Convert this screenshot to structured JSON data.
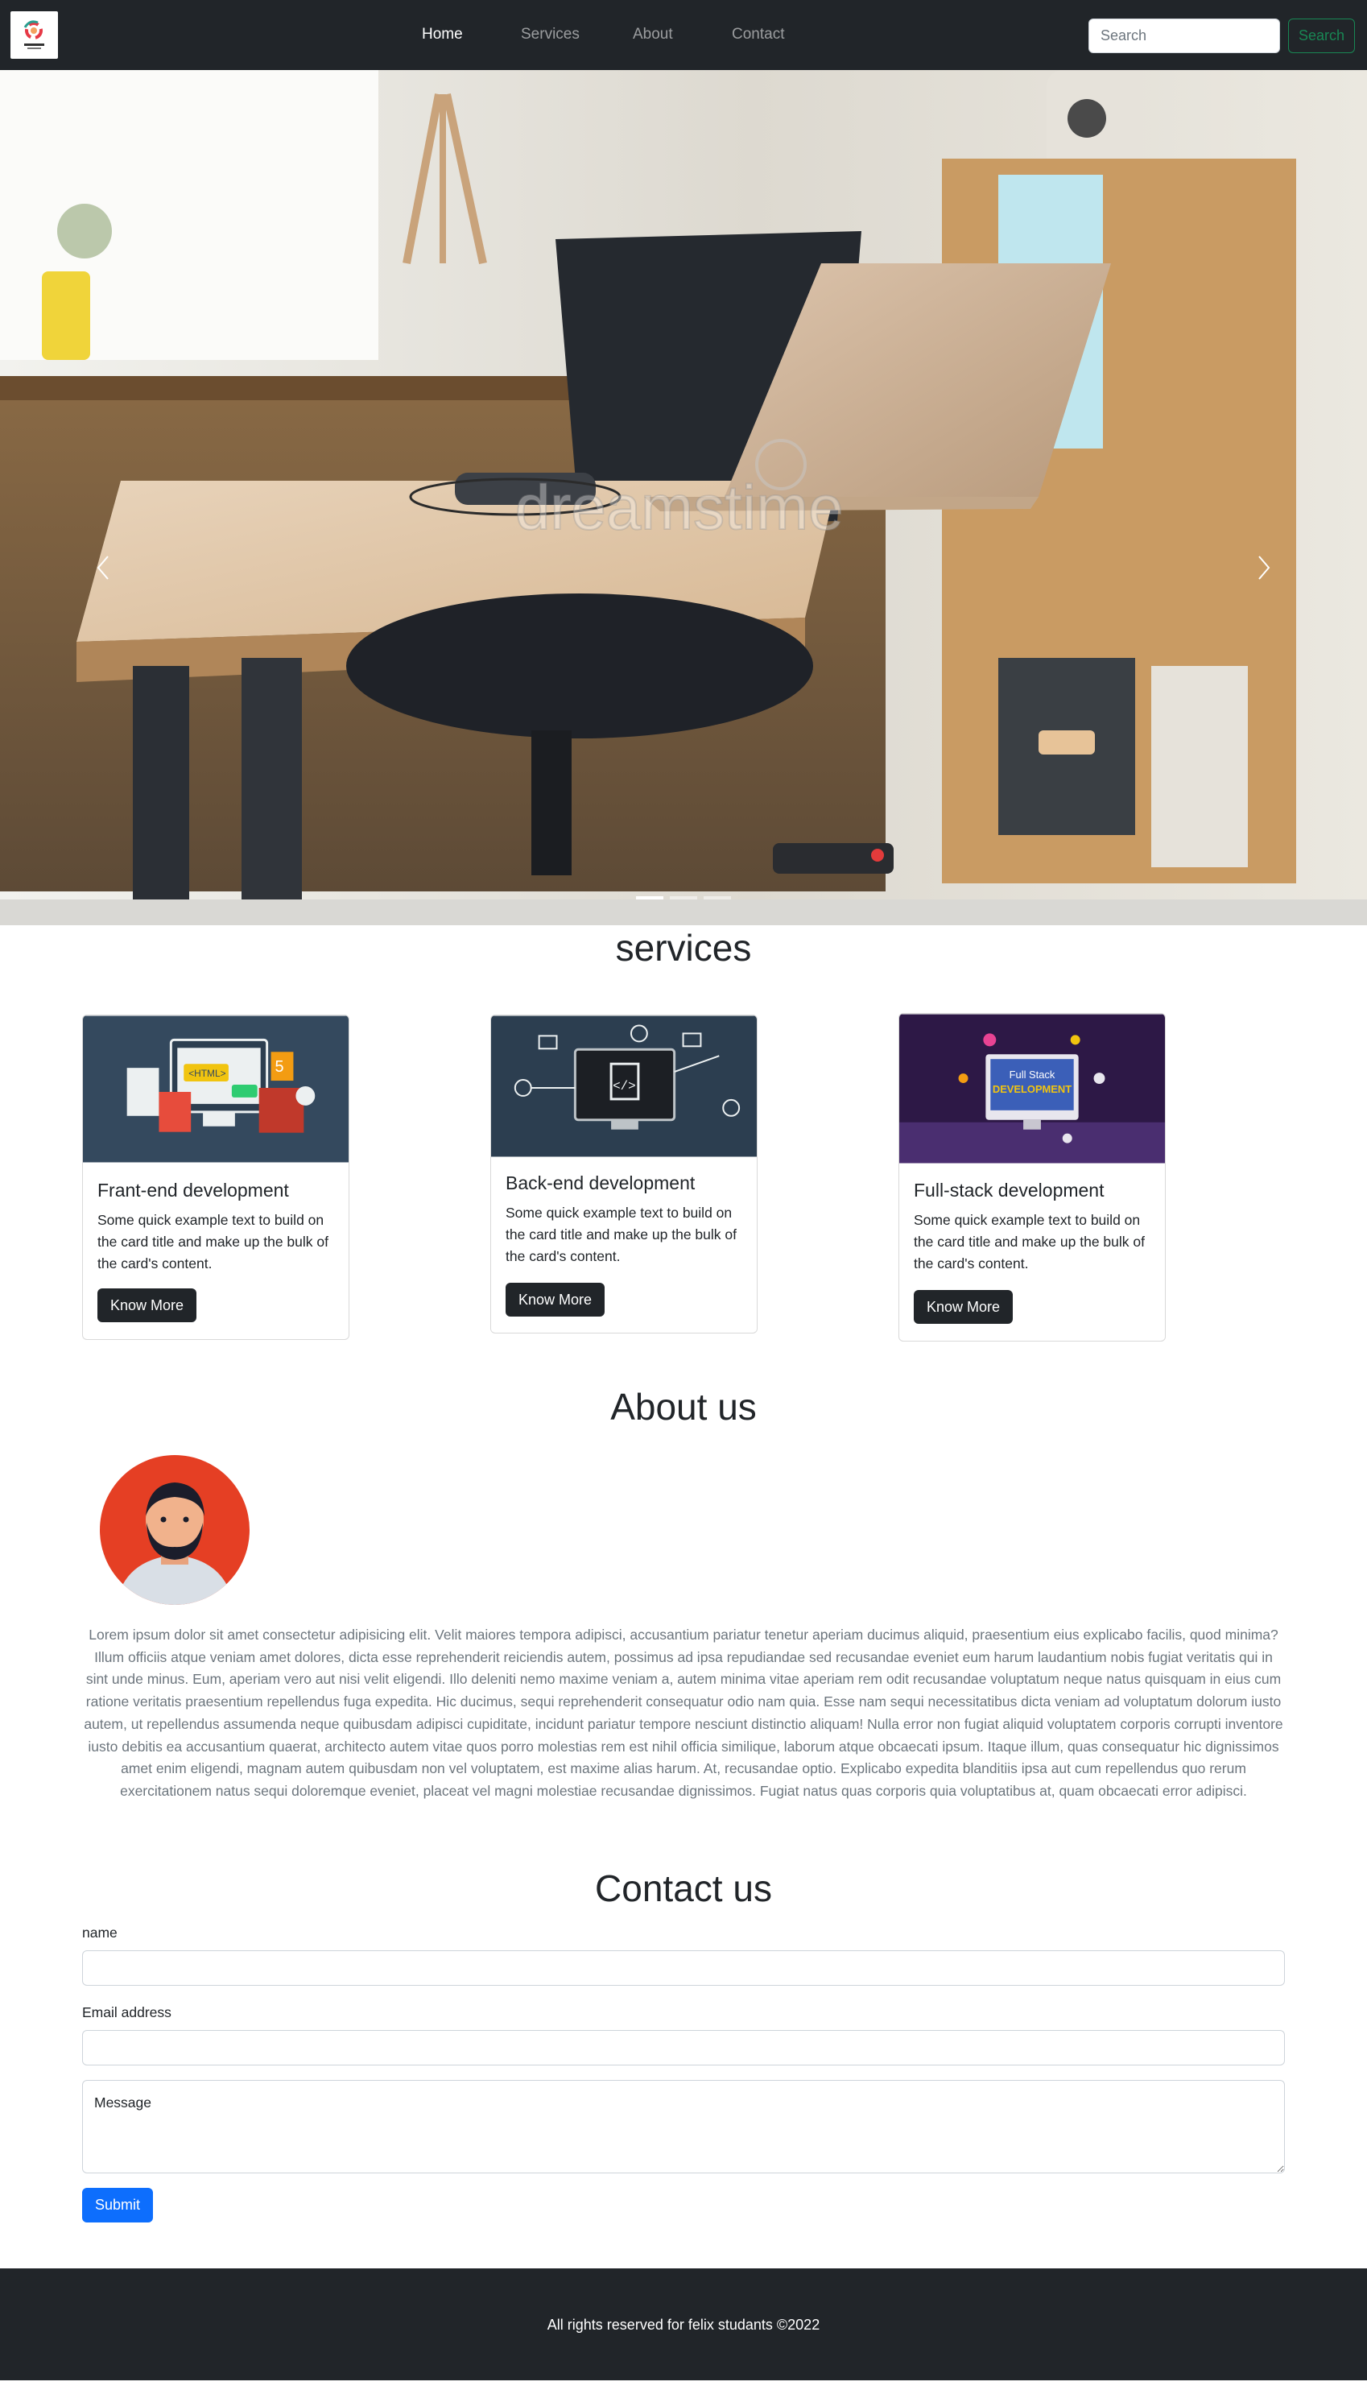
{
  "nav": {
    "logo_icon": "company-logo-icon",
    "links": [
      "Home",
      "Services",
      "About",
      "Contact"
    ],
    "active": "Home",
    "search_placeholder": "Search",
    "search_button": "Search"
  },
  "hero": {
    "image_icon": "office-desk-laptop-photo",
    "prev_icon": "chevron-left-icon",
    "next_icon": "chevron-right-icon",
    "slides_total": 3,
    "active_slide": 1
  },
  "services": {
    "title": "services",
    "cards": [
      {
        "image_icon": "web-frontend-illustration",
        "title": "Frant-end development",
        "text": "Some quick example text to build on the card title and make up the bulk of the card's content.",
        "button": "Know More"
      },
      {
        "image_icon": "code-monitor-illustration",
        "title": "Back-end development",
        "text": "Some quick example text to build on the card title and make up the bulk of the card's content.",
        "button": "Know More"
      },
      {
        "image_icon": "fullstack-monitor-illustration",
        "image_caption_line1": "Full Stack",
        "image_caption_line2": "DEVELOPMENT",
        "title": "Full-stack development",
        "text": "Some quick example text to build on the card title and make up the bulk of the card's content.",
        "button": "Know More"
      }
    ]
  },
  "about": {
    "title": "About us",
    "avatar_icon": "bearded-man-avatar",
    "text": "Lorem ipsum dolor sit amet consectetur adipisicing elit. Velit maiores tempora adipisci, accusantium pariatur tenetur aperiam ducimus aliquid, praesentium eius explicabo facilis, quod minima? Illum officiis atque veniam amet dolores, dicta esse reprehenderit reiciendis autem, possimus ad ipsa repudiandae sed recusandae eveniet eum harum laudantium nobis fugiat veritatis qui in sint unde minus. Eum, aperiam vero aut nisi velit eligendi. Illo deleniti nemo maxime veniam a, autem minima vitae aperiam rem odit recusandae voluptatum neque natus quisquam in eius cum ratione veritatis praesentium repellendus fuga expedita. Hic ducimus, sequi reprehenderit consequatur odio nam quia. Esse nam sequi necessitatibus dicta veniam ad voluptatum dolorum iusto autem, ut repellendus assumenda neque quibusdam adipisci cupiditate, incidunt pariatur tempore nesciunt distinctio aliquam! Nulla error non fugiat aliquid voluptatem corporis corrupti inventore iusto debitis ea accusantium quaerat, architecto autem vitae quos porro molestias rem est nihil officia similique, laborum atque obcaecati ipsum. Itaque illum, quas consequatur hic dignissimos amet enim eligendi, magnam autem quibusdam non vel voluptatem, est maxime alias harum. At, recusandae optio. Explicabo expedita blanditiis ipsa aut cum repellendus quo rerum exercitationem natus sequi doloremque eveniet, placeat vel magni molestiae recusandae dignissimos. Fugiat natus quas corporis quia voluptatibus at, quam obcaecati error adipisci."
  },
  "contact": {
    "title": "Contact us",
    "name_label": "name",
    "name_value": "",
    "email_label": "Email address",
    "email_value": "",
    "message_placeholder": "Message",
    "submit": "Submit"
  },
  "footer": {
    "text": "All rights reserved for felix studants ©2022"
  },
  "colors": {
    "navbar": "#212529",
    "primary": "#0d6efd",
    "success": "#198754",
    "muted": "#6c757d"
  }
}
